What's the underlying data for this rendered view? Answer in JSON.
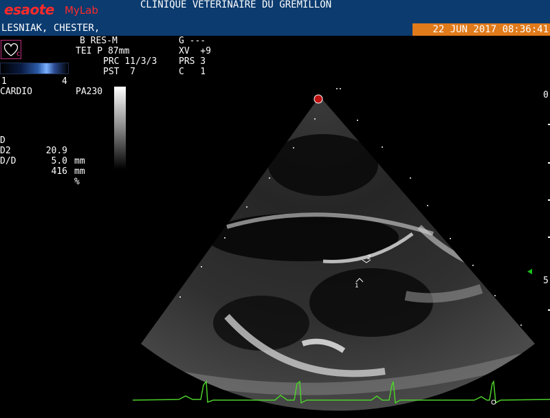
{
  "header": {
    "brand": "esaote",
    "product": "MyLab",
    "clinic": "CLINIQUE VETERINAIRE DU GREMILLON",
    "patient": "LESNIAK, CHESTER,",
    "datetime": "22 JUN 2017 08:36:41"
  },
  "params": {
    "row1": "B RES-M",
    "row2": "TEI P 87mm",
    "row3": "PRC 11/3/3",
    "row4": "PST  7",
    "g": "G ---",
    "xv": "XV  +9",
    "prs": "PRS 3",
    "c": "C   1"
  },
  "heart_label": "c",
  "colorbar": {
    "min": "1",
    "max": "4"
  },
  "preset": "CARDIO",
  "probe": "PA230",
  "measurements": [
    {
      "label": "D",
      "value": "20.9",
      "unit": "mm"
    },
    {
      "label": "D2",
      "value": "5.0",
      "unit": "mm"
    },
    {
      "label": "D/D",
      "value": "416",
      "unit": "%"
    }
  ],
  "depth_scale": {
    "top": "0",
    "mid": "5"
  },
  "calipers": {
    "marker1": "1",
    "marker2": "2"
  },
  "colors": {
    "header_bg": "#0b3b6f",
    "datetime_bg": "#e07a1a",
    "ecg": "#4cd12a",
    "brand": "#ff2a2a",
    "depth_marker": "#19c219"
  }
}
